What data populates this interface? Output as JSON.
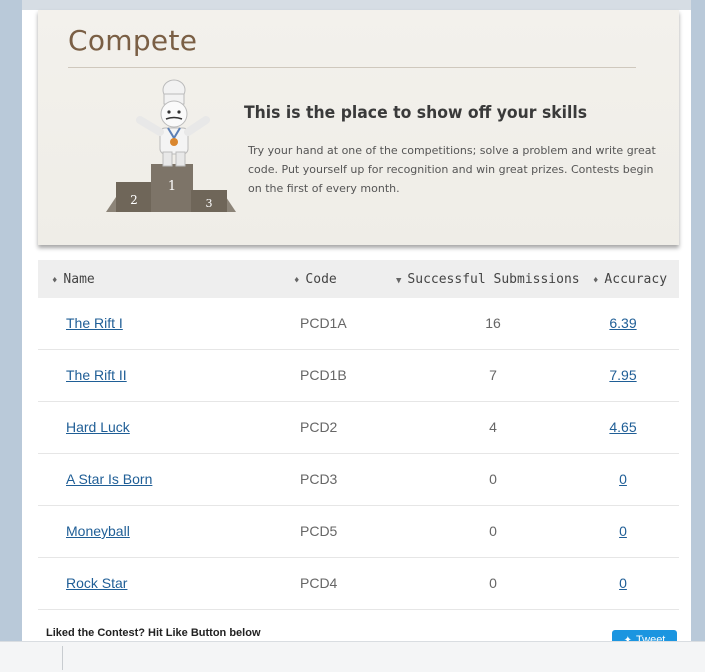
{
  "banner": {
    "title": "Compete",
    "heading": "This is the place to show off your skills",
    "text": "Try your hand at one of the competitions; solve a problem and write great code. Put yourself up for recognition and win great prizes. Contests begin on the first of every month.",
    "podium_labels": [
      "2",
      "1",
      "3"
    ]
  },
  "table": {
    "headers": {
      "name": "Name",
      "code": "Code",
      "submissions": "Successful Submissions",
      "accuracy": "Accuracy"
    },
    "rows": [
      {
        "name": "The Rift I",
        "code": "PCD1A",
        "submissions": "16",
        "accuracy": "6.39"
      },
      {
        "name": "The Rift II",
        "code": "PCD1B",
        "submissions": "7",
        "accuracy": "7.95"
      },
      {
        "name": "Hard Luck",
        "code": "PCD2",
        "submissions": "4",
        "accuracy": "4.65"
      },
      {
        "name": "A Star Is Born",
        "code": "PCD3",
        "submissions": "0",
        "accuracy": "0"
      },
      {
        "name": "Moneyball",
        "code": "PCD5",
        "submissions": "0",
        "accuracy": "0"
      },
      {
        "name": "Rock Star",
        "code": "PCD4",
        "submissions": "0",
        "accuracy": "0"
      }
    ]
  },
  "footer": {
    "like_prompt": "Liked the Contest? Hit Like Button below",
    "tweet_label": "Tweet"
  },
  "colors": {
    "title_brown": "#7a5f45",
    "link_blue": "#1f5e96",
    "tweet_blue": "#1b95e0"
  }
}
